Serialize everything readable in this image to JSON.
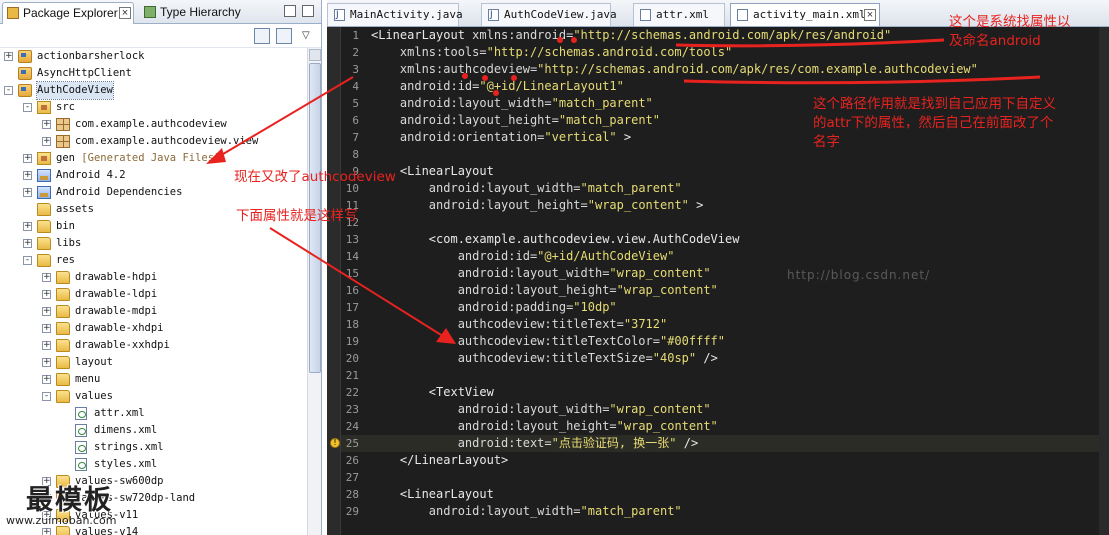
{
  "left_panel": {
    "tabs": [
      {
        "label": "Package Explorer",
        "active": true
      },
      {
        "label": "Type Hierarchy",
        "active": false
      }
    ],
    "tree": [
      {
        "label": "actionbarsherlock",
        "icon": "project-icon",
        "expander": "+"
      },
      {
        "label": "AsyncHttpClient",
        "icon": "project-icon",
        "expander": ""
      },
      {
        "label": "AuthCodeView",
        "icon": "project-icon",
        "expander": "-",
        "selected": true
      },
      {
        "label": "src",
        "icon": "source-folder-icon",
        "expander": "-"
      },
      {
        "label": "com.example.authcodeview",
        "icon": "package-icon",
        "expander": "+"
      },
      {
        "label": "com.example.authcodeview.view",
        "icon": "package-icon",
        "expander": "+"
      },
      {
        "label": "gen",
        "hint": "[Generated Java Files]",
        "icon": "source-folder-icon",
        "expander": "+"
      },
      {
        "label": "Android 4.2",
        "icon": "library-icon",
        "expander": "+"
      },
      {
        "label": "Android Dependencies",
        "icon": "library-icon",
        "expander": "+"
      },
      {
        "label": "assets",
        "icon": "folder-icon",
        "expander": ""
      },
      {
        "label": "bin",
        "icon": "folder-icon",
        "expander": "+"
      },
      {
        "label": "libs",
        "icon": "folder-icon",
        "expander": "+"
      },
      {
        "label": "res",
        "icon": "folder-icon",
        "expander": "-"
      },
      {
        "label": "drawable-hdpi",
        "icon": "folder-icon",
        "expander": "+"
      },
      {
        "label": "drawable-ldpi",
        "icon": "folder-icon",
        "expander": "+"
      },
      {
        "label": "drawable-mdpi",
        "icon": "folder-icon",
        "expander": "+"
      },
      {
        "label": "drawable-xhdpi",
        "icon": "folder-icon",
        "expander": "+"
      },
      {
        "label": "drawable-xxhdpi",
        "icon": "folder-icon",
        "expander": "+"
      },
      {
        "label": "layout",
        "icon": "folder-icon",
        "expander": "+"
      },
      {
        "label": "menu",
        "icon": "folder-icon",
        "expander": "+"
      },
      {
        "label": "values",
        "icon": "folder-icon",
        "expander": "-"
      },
      {
        "label": "attr.xml",
        "icon": "xml-file-icon",
        "expander": ""
      },
      {
        "label": "dimens.xml",
        "icon": "xml-file-icon",
        "expander": ""
      },
      {
        "label": "strings.xml",
        "icon": "xml-file-icon",
        "expander": ""
      },
      {
        "label": "styles.xml",
        "icon": "xml-file-icon",
        "expander": ""
      },
      {
        "label": "values-sw600dp",
        "icon": "folder-icon",
        "expander": "+"
      },
      {
        "label": "values-sw720dp-land",
        "icon": "folder-icon",
        "expander": "+"
      },
      {
        "label": "values-v11",
        "icon": "folder-icon",
        "expander": "+"
      },
      {
        "label": "values-v14",
        "icon": "folder-icon",
        "expander": "+"
      }
    ]
  },
  "editor": {
    "tabs": [
      {
        "label": "MainActivity.java",
        "icon": "java-file-icon",
        "active": false
      },
      {
        "label": "AuthCodeView.java",
        "icon": "java-file-icon",
        "active": false
      },
      {
        "label": "attr.xml",
        "icon": "xml-file-icon",
        "active": false
      },
      {
        "label": "activity_main.xml",
        "icon": "xml-file-icon",
        "active": true
      }
    ],
    "lines": [
      {
        "n": "1",
        "tokens": [
          [
            "tag",
            "<LinearLayout "
          ],
          [
            "attr",
            "xmlns:android="
          ],
          [
            "val",
            "\"http://schemas.android.com/apk/res/android\""
          ]
        ]
      },
      {
        "n": "2",
        "tokens": [
          [
            "attr",
            "    xmlns:tools="
          ],
          [
            "val",
            "\"http://schemas.android.com/tools\""
          ]
        ]
      },
      {
        "n": "3",
        "tokens": [
          [
            "attr",
            "    xmlns:authcodeview="
          ],
          [
            "val",
            "\"http://schemas.android.com/apk/res/com.example.authcodeview\""
          ]
        ]
      },
      {
        "n": "4",
        "tokens": [
          [
            "attr",
            "    android:id="
          ],
          [
            "val",
            "\"@+id/LinearLayout1\""
          ]
        ]
      },
      {
        "n": "5",
        "tokens": [
          [
            "attr",
            "    android:layout_width="
          ],
          [
            "val",
            "\"match_parent\""
          ]
        ]
      },
      {
        "n": "6",
        "tokens": [
          [
            "attr",
            "    android:layout_height="
          ],
          [
            "val",
            "\"match_parent\""
          ]
        ]
      },
      {
        "n": "7",
        "tokens": [
          [
            "attr",
            "    android:orientation="
          ],
          [
            "val",
            "\"vertical\""
          ],
          [
            "tag",
            " >"
          ]
        ]
      },
      {
        "n": "8",
        "tokens": []
      },
      {
        "n": "9",
        "tokens": [
          [
            "tag",
            "    <LinearLayout"
          ]
        ]
      },
      {
        "n": "10",
        "tokens": [
          [
            "attr",
            "        android:layout_width="
          ],
          [
            "val",
            "\"match_parent\""
          ]
        ]
      },
      {
        "n": "11",
        "tokens": [
          [
            "attr",
            "        android:layout_height="
          ],
          [
            "val",
            "\"wrap_content\""
          ],
          [
            "tag",
            " >"
          ]
        ]
      },
      {
        "n": "12",
        "tokens": []
      },
      {
        "n": "13",
        "tokens": [
          [
            "tag",
            "        <com.example.authcodeview.view.AuthCodeView"
          ]
        ]
      },
      {
        "n": "14",
        "tokens": [
          [
            "attr",
            "            android:id="
          ],
          [
            "val",
            "\"@+id/AuthCodeView\""
          ]
        ]
      },
      {
        "n": "15",
        "tokens": [
          [
            "attr",
            "            android:layout_width="
          ],
          [
            "val",
            "\"wrap_content\""
          ]
        ]
      },
      {
        "n": "16",
        "tokens": [
          [
            "attr",
            "            android:layout_height="
          ],
          [
            "val",
            "\"wrap_content\""
          ]
        ]
      },
      {
        "n": "17",
        "tokens": [
          [
            "attr",
            "            android:padding="
          ],
          [
            "val",
            "\"10dp\""
          ]
        ]
      },
      {
        "n": "18",
        "tokens": [
          [
            "attr",
            "            authcodeview:titleText="
          ],
          [
            "val",
            "\"3712\""
          ]
        ]
      },
      {
        "n": "19",
        "tokens": [
          [
            "attr",
            "            authcodeview:titleTextColor="
          ],
          [
            "val",
            "\"#00ffff\""
          ]
        ]
      },
      {
        "n": "20",
        "tokens": [
          [
            "attr",
            "            authcodeview:titleTextSize="
          ],
          [
            "val",
            "\"40sp\""
          ],
          [
            "tag",
            " />"
          ]
        ]
      },
      {
        "n": "21",
        "tokens": []
      },
      {
        "n": "22",
        "tokens": [
          [
            "tag",
            "        <TextView"
          ]
        ]
      },
      {
        "n": "23",
        "tokens": [
          [
            "attr",
            "            android:layout_width="
          ],
          [
            "val",
            "\"wrap_content\""
          ]
        ]
      },
      {
        "n": "24",
        "tokens": [
          [
            "attr",
            "            android:layout_height="
          ],
          [
            "val",
            "\"wrap_content\""
          ]
        ]
      },
      {
        "n": "25",
        "tokens": [
          [
            "attr",
            "            android:text="
          ],
          [
            "val",
            "\"点击验证码, 换一张\""
          ],
          [
            "tag",
            " />"
          ]
        ],
        "highlight": true,
        "warning": true
      },
      {
        "n": "26",
        "tokens": [
          [
            "tag",
            "    </LinearLayout>"
          ]
        ]
      },
      {
        "n": "27",
        "tokens": []
      },
      {
        "n": "28",
        "tokens": [
          [
            "tag",
            "    <LinearLayout"
          ]
        ]
      },
      {
        "n": "29",
        "tokens": [
          [
            "attr",
            "        android:layout_width="
          ],
          [
            "val",
            "\"match_parent\""
          ]
        ]
      }
    ]
  },
  "annotations": {
    "note_top_right": [
      "这个是系统找属性以",
      "及命名android"
    ],
    "note_path": [
      "这个路径作用就是找到自己应用下自定义",
      "的attr下的属性，然后自己在前面改了个",
      "名字"
    ],
    "note_changed": "现在又改了authcodeview",
    "note_below": "下面属性就是这样写",
    "color": "#e8231f"
  },
  "watermark": {
    "big": "最模板",
    "small": "www.zuimoban.com",
    "faint": "http://blog.csdn.net/"
  }
}
